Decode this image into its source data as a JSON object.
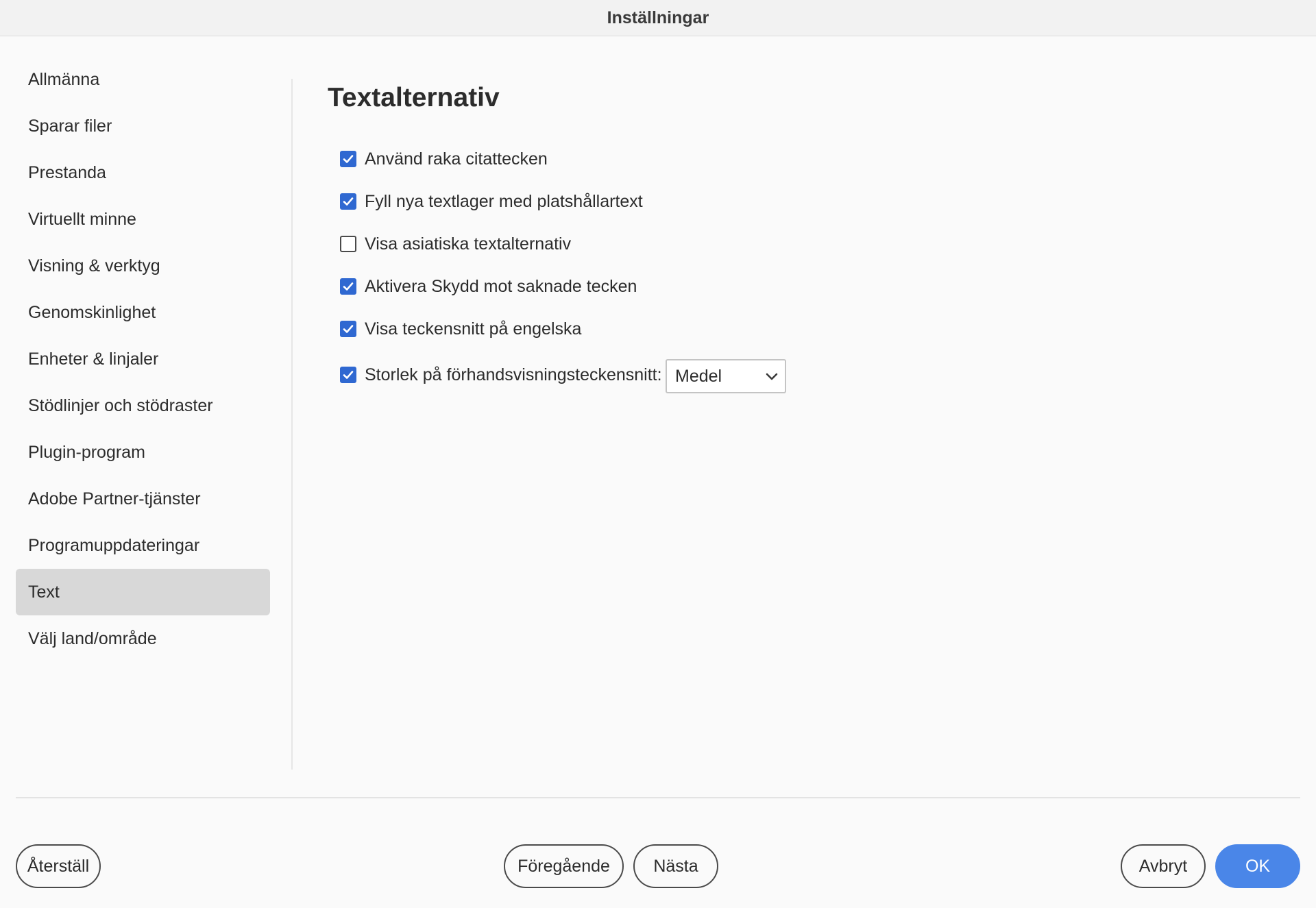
{
  "window": {
    "title": "Inställningar"
  },
  "sidebar": {
    "items": [
      {
        "label": "Allmänna",
        "selected": false
      },
      {
        "label": "Sparar filer",
        "selected": false
      },
      {
        "label": "Prestanda",
        "selected": false
      },
      {
        "label": "Virtuellt minne",
        "selected": false
      },
      {
        "label": "Visning & verktyg",
        "selected": false
      },
      {
        "label": "Genomskinlighet",
        "selected": false
      },
      {
        "label": "Enheter & linjaler",
        "selected": false
      },
      {
        "label": "Stödlinjer och stödraster",
        "selected": false
      },
      {
        "label": "Plugin-program",
        "selected": false
      },
      {
        "label": "Adobe Partner-tjänster",
        "selected": false
      },
      {
        "label": "Programuppdateringar",
        "selected": false
      },
      {
        "label": "Text",
        "selected": true
      },
      {
        "label": "Välj land/område",
        "selected": false
      }
    ]
  },
  "main": {
    "title": "Textalternativ",
    "options": [
      {
        "label": "Använd raka citattecken",
        "checked": true
      },
      {
        "label": "Fyll nya textlager med platshållartext",
        "checked": true
      },
      {
        "label": "Visa asiatiska textalternativ",
        "checked": false
      },
      {
        "label": "Aktivera Skydd mot saknade tecken",
        "checked": true
      },
      {
        "label": "Visa teckensnitt på engelska",
        "checked": true
      },
      {
        "label": "Storlek på förhandsvisningsteckensnitt:",
        "checked": true
      }
    ],
    "preview_size": {
      "value": "Medel"
    }
  },
  "footer": {
    "reset_label": "Återställ",
    "previous_label": "Föregående",
    "next_label": "Nästa",
    "cancel_label": "Avbryt",
    "ok_label": "OK"
  },
  "colors": {
    "accent": "#2f68d1",
    "primary_button": "#4a86e8",
    "selected_item": "#d8d8d8"
  },
  "icons": {
    "checkbox_checked": "checkmark-icon",
    "select_arrow": "chevron-down-icon"
  }
}
